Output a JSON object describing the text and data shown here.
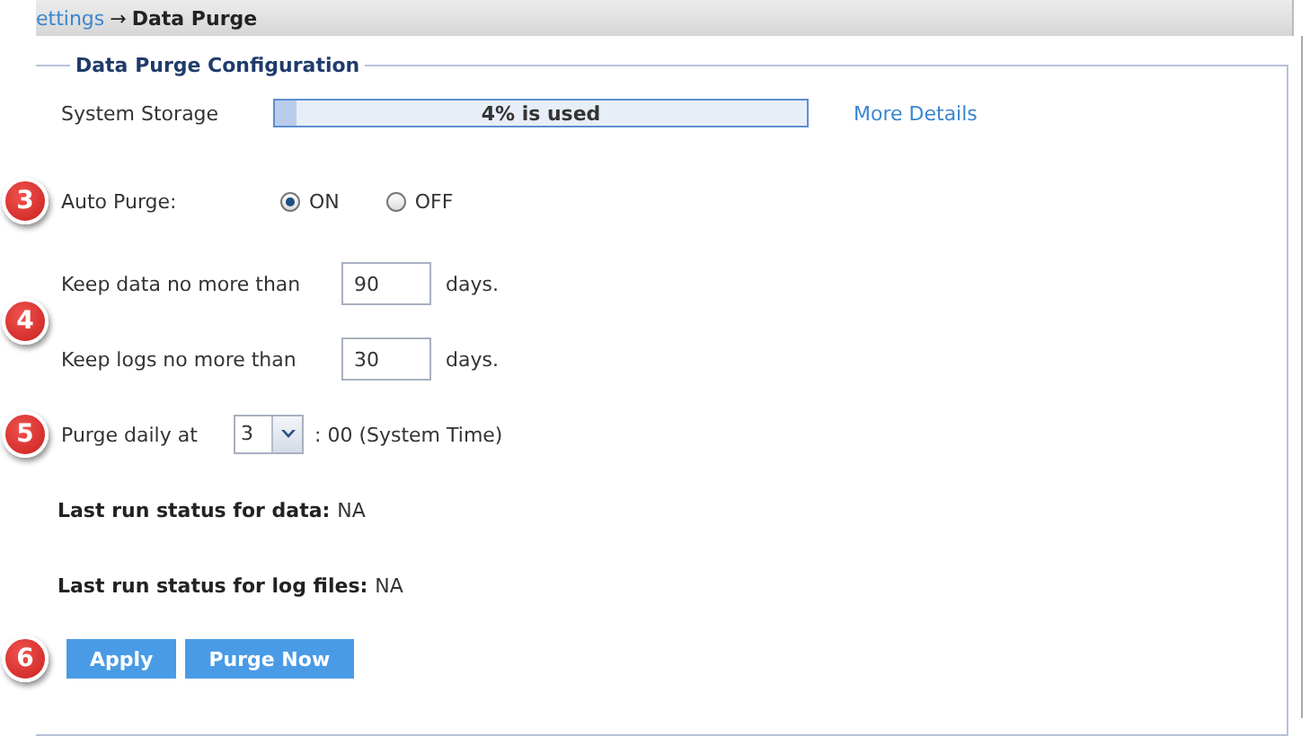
{
  "breadcrumb": {
    "link": "ettings",
    "arrow": "→",
    "current": "Data Purge"
  },
  "legend": "Data Purge Configuration",
  "storage": {
    "label": "System Storage",
    "level": 0.04,
    "text": "4% is used",
    "link": "More Details"
  },
  "auto_purge": {
    "badge": "3",
    "label": "Auto Purge:",
    "options": [
      {
        "label": "ON",
        "selected": true
      },
      {
        "label": "OFF",
        "selected": false
      }
    ]
  },
  "retention": {
    "badge": "4",
    "rows": [
      {
        "label": "Keep data no more than",
        "value": "90",
        "unit": "days."
      },
      {
        "label": "Keep logs no more than",
        "value": "30",
        "unit": "days."
      }
    ]
  },
  "schedule": {
    "badge": "5",
    "label": "Purge daily at",
    "hour": "3",
    "suffix": ": 00 (System Time)"
  },
  "status": [
    {
      "label": "Last run status for data:",
      "value": "NA"
    },
    {
      "label": "Last run status for log files:",
      "value": "NA"
    }
  ],
  "actions": {
    "badge": "6",
    "buttons": [
      "Apply",
      "Purge Now"
    ]
  }
}
